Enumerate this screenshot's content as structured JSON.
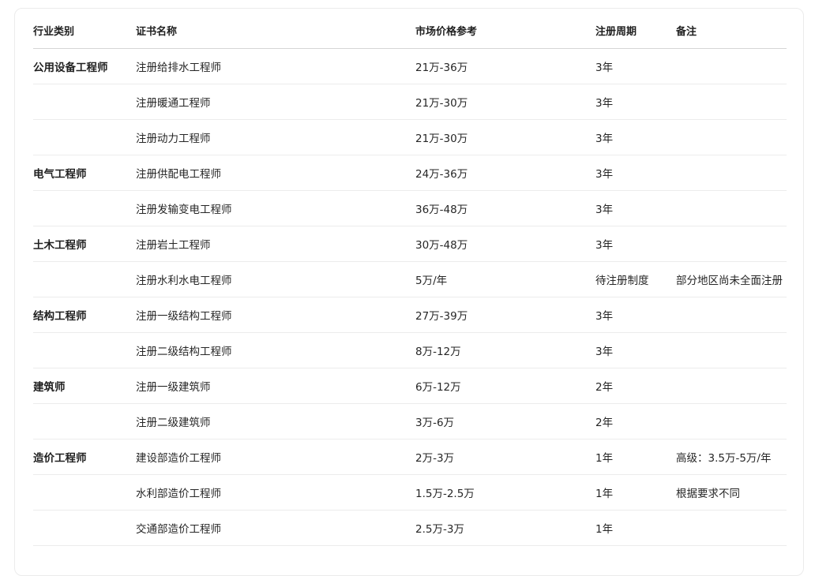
{
  "headers": [
    "行业类别",
    "证书名称",
    "市场价格参考",
    "注册周期",
    "备注"
  ],
  "rows": [
    {
      "category": "公用设备工程师",
      "name": "注册给排水工程师",
      "price": "21万-36万",
      "cycle": "3年",
      "note": ""
    },
    {
      "category": "",
      "name": "注册暖通工程师",
      "price": "21万-30万",
      "cycle": "3年",
      "note": ""
    },
    {
      "category": "",
      "name": "注册动力工程师",
      "price": "21万-30万",
      "cycle": "3年",
      "note": ""
    },
    {
      "category": "电气工程师",
      "name": "注册供配电工程师",
      "price": "24万-36万",
      "cycle": "3年",
      "note": ""
    },
    {
      "category": "",
      "name": "注册发输变电工程师",
      "price": "36万-48万",
      "cycle": "3年",
      "note": ""
    },
    {
      "category": "土木工程师",
      "name": "注册岩土工程师",
      "price": "30万-48万",
      "cycle": "3年",
      "note": ""
    },
    {
      "category": "",
      "name": "注册水利水电工程师",
      "price": "5万/年",
      "cycle": "待注册制度",
      "note": "部分地区尚未全面注册"
    },
    {
      "category": "结构工程师",
      "name": "注册一级结构工程师",
      "price": "27万-39万",
      "cycle": "3年",
      "note": ""
    },
    {
      "category": "",
      "name": "注册二级结构工程师",
      "price": "8万-12万",
      "cycle": "3年",
      "note": ""
    },
    {
      "category": "建筑师",
      "name": "注册一级建筑师",
      "price": "6万-12万",
      "cycle": "2年",
      "note": ""
    },
    {
      "category": "",
      "name": "注册二级建筑师",
      "price": "3万-6万",
      "cycle": "2年",
      "note": ""
    },
    {
      "category": "造价工程师",
      "name": "建设部造价工程师",
      "price": "2万-3万",
      "cycle": "1年",
      "note": "高级：3.5万-5万/年"
    },
    {
      "category": "",
      "name": "水利部造价工程师",
      "price": "1.5万-2.5万",
      "cycle": "1年",
      "note": "根据要求不同"
    },
    {
      "category": "",
      "name": "交通部造价工程师",
      "price": "2.5万-3万",
      "cycle": "1年",
      "note": ""
    }
  ]
}
